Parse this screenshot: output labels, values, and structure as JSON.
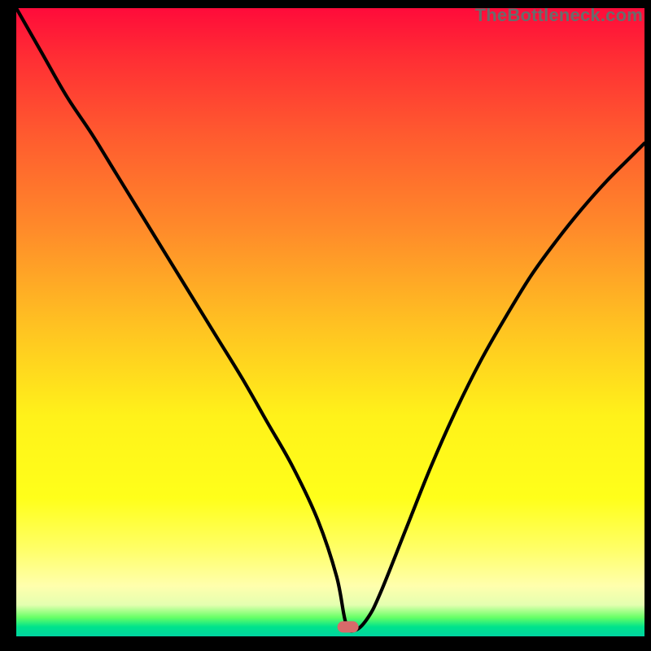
{
  "watermark": "TheBottleneck.com",
  "colors": {
    "curve": "#000000",
    "marker": "#d86a6a",
    "gradient_top": "#ff0b3a",
    "gradient_bottom": "#00d4a0"
  },
  "chart_data": {
    "type": "line",
    "title": "",
    "subtitle": "",
    "xlabel": "",
    "ylabel": "",
    "xlim": [
      0,
      100
    ],
    "ylim": [
      0,
      100
    ],
    "grid": false,
    "legend": false,
    "series": [
      {
        "name": "bottleneck-curve",
        "x": [
          0,
          4,
          8,
          12,
          16,
          20,
          24,
          28,
          32,
          36,
          40,
          44,
          48,
          51,
          52.5,
          54,
          56,
          58,
          62,
          66,
          70,
          74,
          78,
          82,
          86,
          90,
          94,
          98,
          100
        ],
        "values": [
          100,
          93,
          86,
          80,
          73.5,
          67,
          60.5,
          54,
          47.5,
          41,
          34,
          27,
          18.5,
          9.5,
          2,
          1,
          3,
          7,
          17,
          27,
          36,
          44,
          51,
          57.5,
          63,
          68,
          72.5,
          76.5,
          78.5
        ]
      }
    ],
    "marker": {
      "x": 52.8,
      "y": 1.5,
      "label": ""
    }
  }
}
